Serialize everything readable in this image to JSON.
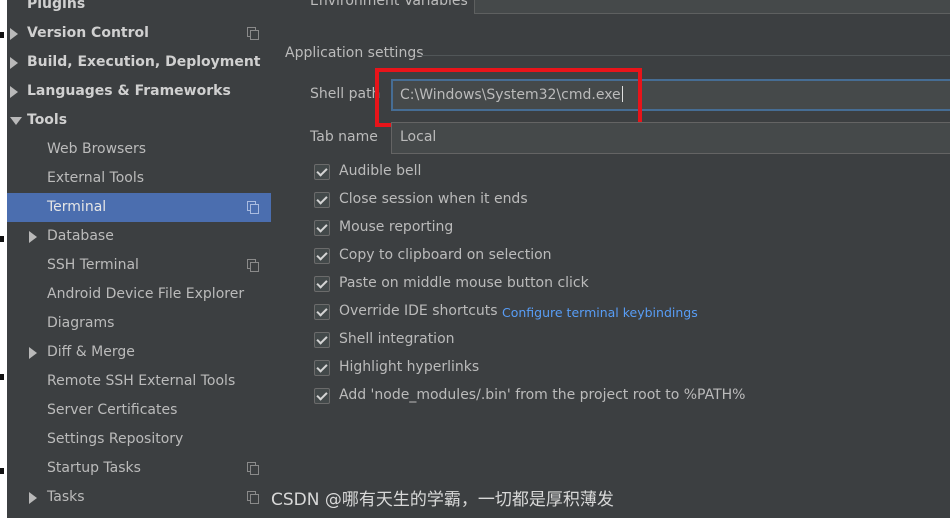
{
  "sidebar": {
    "items": [
      {
        "label": "Plugins",
        "level": 0,
        "bold": true,
        "arrow": "none",
        "copy": false,
        "selected": false
      },
      {
        "label": "Version Control",
        "level": 0,
        "bold": true,
        "arrow": "right",
        "copy": true,
        "selected": false
      },
      {
        "label": "Build, Execution, Deployment",
        "level": 0,
        "bold": true,
        "arrow": "right",
        "copy": false,
        "selected": false
      },
      {
        "label": "Languages & Frameworks",
        "level": 0,
        "bold": true,
        "arrow": "right",
        "copy": false,
        "selected": false
      },
      {
        "label": "Tools",
        "level": 0,
        "bold": true,
        "arrow": "down",
        "copy": false,
        "selected": false
      },
      {
        "label": "Web Browsers",
        "level": 1,
        "bold": false,
        "arrow": "none",
        "copy": false,
        "selected": false
      },
      {
        "label": "External Tools",
        "level": 1,
        "bold": false,
        "arrow": "none",
        "copy": false,
        "selected": false
      },
      {
        "label": "Terminal",
        "level": 1,
        "bold": false,
        "arrow": "none",
        "copy": true,
        "selected": true
      },
      {
        "label": "Database",
        "level": 1,
        "bold": false,
        "arrow": "right",
        "copy": false,
        "selected": false
      },
      {
        "label": "SSH Terminal",
        "level": 1,
        "bold": false,
        "arrow": "none",
        "copy": true,
        "selected": false
      },
      {
        "label": "Android Device File Explorer",
        "level": 1,
        "bold": false,
        "arrow": "none",
        "copy": false,
        "selected": false
      },
      {
        "label": "Diagrams",
        "level": 1,
        "bold": false,
        "arrow": "none",
        "copy": false,
        "selected": false
      },
      {
        "label": "Diff & Merge",
        "level": 1,
        "bold": false,
        "arrow": "right",
        "copy": false,
        "selected": false
      },
      {
        "label": "Remote SSH External Tools",
        "level": 1,
        "bold": false,
        "arrow": "none",
        "copy": false,
        "selected": false
      },
      {
        "label": "Server Certificates",
        "level": 1,
        "bold": false,
        "arrow": "none",
        "copy": false,
        "selected": false
      },
      {
        "label": "Settings Repository",
        "level": 1,
        "bold": false,
        "arrow": "none",
        "copy": false,
        "selected": false
      },
      {
        "label": "Startup Tasks",
        "level": 1,
        "bold": false,
        "arrow": "none",
        "copy": true,
        "selected": false
      },
      {
        "label": "Tasks",
        "level": 1,
        "bold": false,
        "arrow": "right",
        "copy": true,
        "selected": false
      }
    ]
  },
  "main": {
    "env_label": "Environment Variables",
    "section_title": "Application settings",
    "shell_path": {
      "label": "Shell path",
      "value": "C:\\Windows\\System32\\cmd.exe"
    },
    "tab_name": {
      "label": "Tab name",
      "value": "Local"
    },
    "checkboxes": [
      {
        "label": "Audible bell",
        "checked": true
      },
      {
        "label": "Close session when it ends",
        "checked": true
      },
      {
        "label": "Mouse reporting",
        "checked": true
      },
      {
        "label": "Copy to clipboard on selection",
        "checked": true
      },
      {
        "label": "Paste on middle mouse button click",
        "checked": true
      },
      {
        "label": "Override IDE shortcuts",
        "checked": true,
        "link": "Configure terminal keybindings"
      },
      {
        "label": "Shell integration",
        "checked": true
      },
      {
        "label": "Highlight hyperlinks",
        "checked": true
      },
      {
        "label": "Add 'node_modules/.bin' from the project root to %PATH%",
        "checked": true
      }
    ]
  },
  "watermark": "CSDN @哪有天生的学霸，一切都是厚积薄发",
  "colors": {
    "background": "#3c3f41",
    "selection": "#4b6eaf",
    "link": "#589df6",
    "highlight_box": "#e8141a",
    "focus_border": "#466d94"
  }
}
